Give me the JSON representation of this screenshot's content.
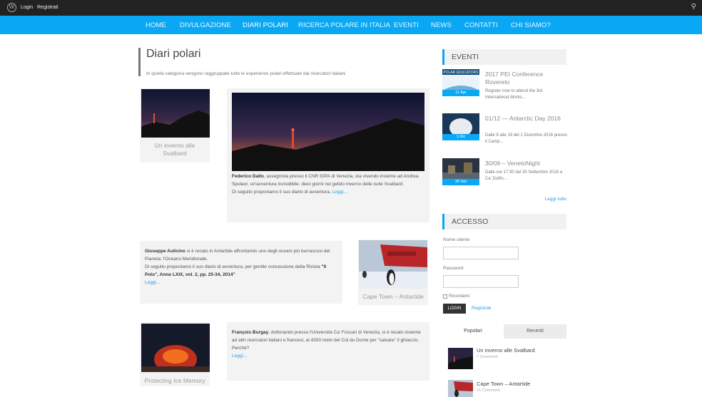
{
  "adminbar": {
    "login": "Login",
    "register": "Registrati"
  },
  "nav": {
    "items": [
      "HOME",
      "DIVULGAZIONE",
      "DIARI POLARI",
      "RICERCA POLARE IN ITALIA",
      "EVENTI",
      "NEWS",
      "CONTATTI",
      "CHI SIAMO?"
    ]
  },
  "page": {
    "title": "Diari polari",
    "subtitle": "In quella categoria vengono raggruppate tutte le esperienze polari effettuate dai ricercatori italiani"
  },
  "posts": [
    {
      "caption": "Un inverno alle Svalbard",
      "author": "Federico Dallo",
      "text": ", assegnista presso il CNR IDPA di Venezia, sta vivendo insieme ad Andrea Spolaor, un'avventura incredibile: dieci giorni nel gelido inverno delle isole Svalbard.",
      "text2": "Di seguito proponiamo il suo diario di avventura.",
      "more": "Leggi..."
    },
    {
      "caption": "Cape Town – Antartide",
      "author": "Giuseppe Aulicino",
      "text": " si è recato in Antartide affrontando uno degli oceani più burrascosi del Pianeta: l'Oceano Meridionale.",
      "text2": "Di seguito proponiamo il suo diario di avventura, per gentile concessione della Rivista",
      "ref": "\"Il Polo\", Anno LXIX, vol. 2, pp. 25-34, 2014\"",
      "more": "Leggi..."
    },
    {
      "caption": "Protecting Ice Memory",
      "author": "François Burgay",
      "text": ", dottorando presso l'Università Ca' Foscari di Venezia, si è recato insieme ad altri ricercatori italiani e francesi, al 4300 metri del Col du Dome per \"salvare\" il ghiaccio. Perché?",
      "more": "Leggi..."
    }
  ],
  "events": {
    "heading": "EVENTI",
    "items": [
      {
        "img_label": "POLAR EDUCATORS",
        "date": "11 Apr",
        "title": "2017 PEI Conference Rovereto",
        "desc": "Register now to attend the 3rd International Works..."
      },
      {
        "date": "1 Dic",
        "title": "01/12 — Antarctic Day 2016",
        "desc": "Dalle 9 alle 19 del 1 Dicembre 2016 presso il Camp..."
      },
      {
        "date": "30 Set",
        "title": "30/09 – VenetoNight",
        "desc": "Dalle ore 17:30 del 30 Settembre 2016 a Ca' Dolfin..."
      }
    ],
    "readall": "Leggi tutto"
  },
  "access": {
    "heading": "ACCESSO",
    "username_label": "Nome utente",
    "password_label": "Password",
    "remember": "Ricordami",
    "login": "LOGIN",
    "register": "Registrati"
  },
  "tabs": {
    "popular": "Popolari",
    "recent": "Recenti"
  },
  "popular": [
    {
      "title": "Un inverno alle Svalbard",
      "sub": "7 Commenti"
    },
    {
      "title": "Cape Town – Antartide",
      "sub": "15 Commenti"
    }
  ],
  "colors": {
    "accent": "#0aa8f4",
    "adminbar": "#222222"
  }
}
